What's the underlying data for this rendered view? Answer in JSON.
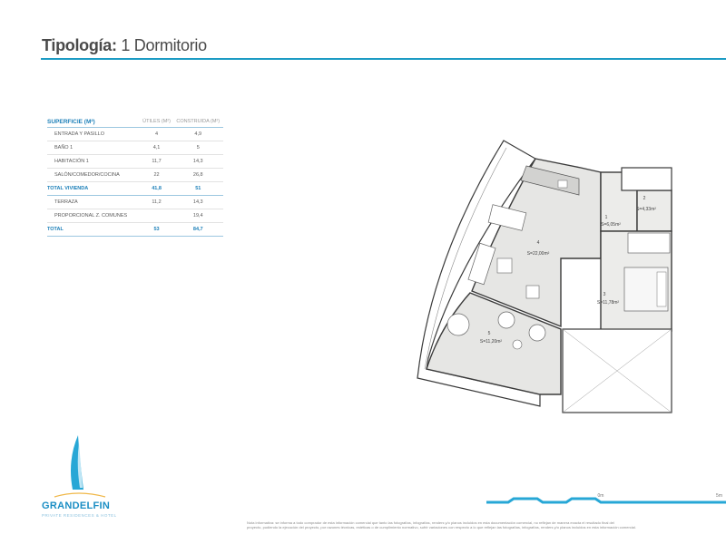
{
  "header": {
    "title_bold": "Tipología:",
    "title_rest": "1 Dormitorio"
  },
  "surface_table": {
    "heading": "SUPERFICIE (M²)",
    "col_useful": "ÚTILES (M²)",
    "col_built": "CONSTRUIDA (M²)",
    "rows": [
      {
        "label": "ENTRADA Y PASILLO",
        "useful": "4",
        "built": "4,9"
      },
      {
        "label": "BAÑO 1",
        "useful": "4,1",
        "built": "5"
      },
      {
        "label": "HABITACIÓN 1",
        "useful": "11,7",
        "built": "14,3"
      },
      {
        "label": "SALÓN/COMEDOR/COCINA",
        "useful": "22",
        "built": "26,8"
      }
    ],
    "total_vivienda": {
      "label": "TOTAL VIVIENDA",
      "useful": "41,8",
      "built": "51"
    },
    "extra_rows": [
      {
        "label": "TERRAZA",
        "useful": "11,2",
        "built": "14,3"
      },
      {
        "label": "PROPORCIONAL Z. COMUNES",
        "useful": "",
        "built": "19,4"
      }
    ],
    "total": {
      "label": "TOTAL",
      "useful": "53",
      "built": "84,7"
    }
  },
  "floor_plan": {
    "rooms": [
      {
        "number": "1",
        "area": "S=6,05m²"
      },
      {
        "number": "2",
        "area": "S=4,33m²"
      },
      {
        "number": "3",
        "area": "S=11,78m²"
      },
      {
        "number": "4",
        "area": "S=22,00m²"
      },
      {
        "number": "5",
        "area": "S=11,20m²"
      }
    ]
  },
  "brand": {
    "name": "GRANDELFIN",
    "tagline": "PRIVATE RESIDENCES & HOTEL"
  },
  "scale_bar": {
    "label_mid": "0m",
    "label_end": "5m"
  },
  "footer": {
    "disclaimer_line1": "Nota informativa: se informa a todo comprador de esta información comercial que tanto las fotografías, infografías, renders y/o planos incluidos en esta documentación comercial, no reflejan de manera exacta el resultado final del",
    "disclaimer_line2": "proyecto, pudiendo la ejecución del proyecto, por razones técnicas, estéticas o de cumplimiento normativo, sufrir variaciones con respecto a lo que reflejan las fotografías, infografías, renders y/o planos incluidos en esta información comercial."
  },
  "colors": {
    "accent": "#1c9bc4",
    "table_blue": "#1b7fb8",
    "wall": "#3a3a3a",
    "floor": "#e6e6e4"
  }
}
